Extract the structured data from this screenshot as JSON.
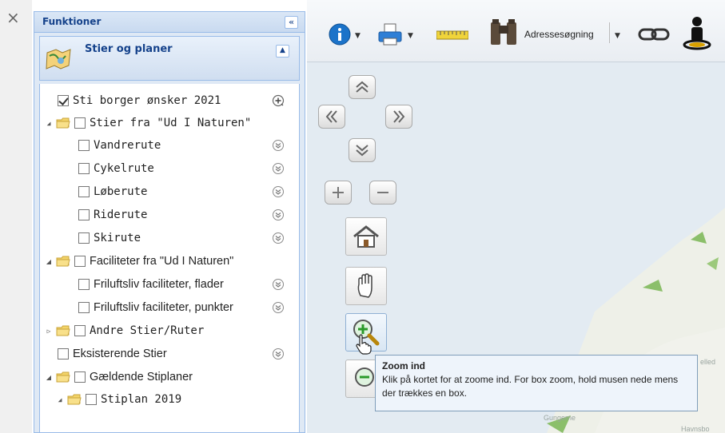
{
  "close": {
    "symbol": "×"
  },
  "panel": {
    "title": "Funktioner",
    "collapse_symbol": "«",
    "subpanel_title": "Stier og planer",
    "subpanel_toggle": "▲"
  },
  "tree": [
    {
      "label": "Sti borger ønsker 2021",
      "checked": true,
      "action": "add-circle-icon"
    },
    {
      "label": "Stier fra \"Ud I Naturen\"",
      "checked": false,
      "folder": true,
      "expanded": true
    },
    {
      "label": "Vandrerute",
      "checked": false,
      "action": "chevron-circle-icon"
    },
    {
      "label": "Cykelrute",
      "checked": false,
      "action": "chevron-circle-icon"
    },
    {
      "label": "Løberute",
      "checked": false,
      "action": "chevron-circle-icon"
    },
    {
      "label": "Riderute",
      "checked": false,
      "action": "chevron-circle-icon"
    },
    {
      "label": "Skirute",
      "checked": false,
      "action": "chevron-circle-icon"
    },
    {
      "label": "Faciliteter fra \"Ud I Naturen\"",
      "checked": false,
      "folder": true,
      "expanded": true
    },
    {
      "label": "Friluftsliv faciliteter, flader",
      "checked": false,
      "action": "chevron-circle-icon"
    },
    {
      "label": "Friluftsliv faciliteter, punkter",
      "checked": false,
      "action": "chevron-circle-icon"
    },
    {
      "label": "Andre Stier/Ruter",
      "checked": false,
      "folder": true,
      "expanded": false
    },
    {
      "label": "Eksisterende Stier",
      "checked": false,
      "action": "chevron-circle-icon"
    },
    {
      "label": "Gældende Stiplaner",
      "checked": false,
      "folder": true,
      "expanded": true
    },
    {
      "label": "Stiplan 2019",
      "checked": false,
      "folder": true,
      "expanded": true
    }
  ],
  "toolbar": {
    "info_icon": "info-icon",
    "print_icon": "printer-icon",
    "measure_icon": "ruler-icon",
    "search_icon": "binoculars-icon",
    "search_label": "Adressesøgning",
    "link_icon": "link-icon",
    "person_icon": "street-view-icon"
  },
  "tooltip": {
    "title": "Zoom ind",
    "body": "Klik på kortet for at zoome ind. For box zoom, hold musen nede mens der trækkes en box."
  },
  "map_labels": {
    "place1": "Gungerne",
    "place2": "elled",
    "place3": "Havnsbo"
  }
}
